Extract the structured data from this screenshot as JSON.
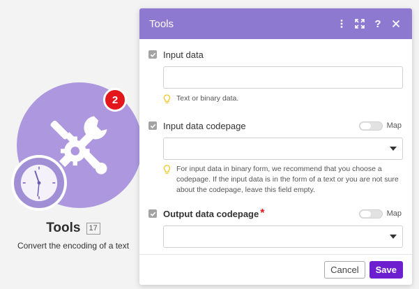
{
  "module": {
    "title": "Tools",
    "id": "17",
    "description": "Convert the encoding of a text",
    "badge_count": "2",
    "color": "#ad98e0"
  },
  "dialog": {
    "title": "Tools",
    "header_color": "#8e79d1",
    "header_buttons": [
      "more-vertical-icon",
      "expand-icon",
      "help-icon",
      "close-icon"
    ],
    "fields": {
      "input_data": {
        "label": "Input data",
        "value": "",
        "hint": "Text or binary data."
      },
      "input_codepage": {
        "label": "Input data codepage",
        "map_label": "Map",
        "value": "",
        "hint": "For input data in binary form, we recommend that you choose a codepage. If the input data is in the form of a text or you are not sure about the codepage, leave this field empty."
      },
      "output_codepage": {
        "label": "Output data codepage",
        "required_mark": "*",
        "map_label": "Map",
        "value": ""
      }
    },
    "footer": {
      "cancel_label": "Cancel",
      "save_label": "Save"
    }
  }
}
